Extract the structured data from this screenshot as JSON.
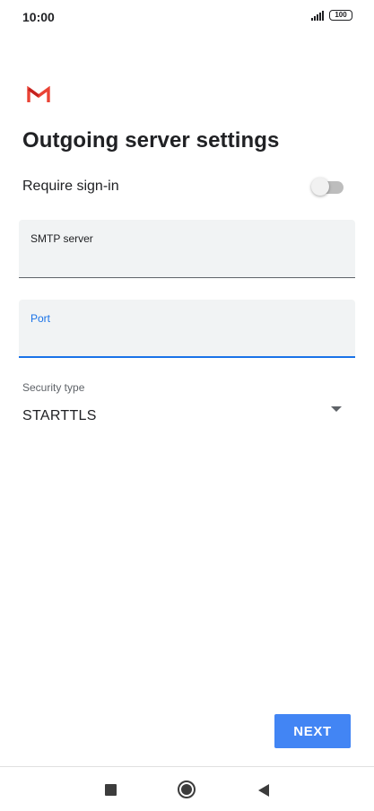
{
  "status_bar": {
    "time": "10:00",
    "battery_level": "100",
    "signal_icon": "signal-bars-icon"
  },
  "app": {
    "logo_icon": "gmail-logo-icon",
    "brand_colors": {
      "red": "#EA4335",
      "dark_red": "#C5221F"
    }
  },
  "page": {
    "title": "Outgoing server settings"
  },
  "require_signin": {
    "label": "Require sign-in",
    "enabled": false
  },
  "smtp_server": {
    "label": "SMTP server",
    "value": ""
  },
  "port": {
    "label": "Port",
    "value": "",
    "focused": true
  },
  "security": {
    "label": "Security type",
    "selected": "STARTTLS",
    "icon": "dropdown-arrow-icon"
  },
  "actions": {
    "next_label": "NEXT"
  },
  "navigation": {
    "recents_icon": "square-recents-icon",
    "home_icon": "circle-home-icon",
    "back_icon": "triangle-back-icon"
  },
  "colors": {
    "accent": "#4285F4",
    "focus": "#1A73E8",
    "field_bg": "#F1F3F4"
  }
}
